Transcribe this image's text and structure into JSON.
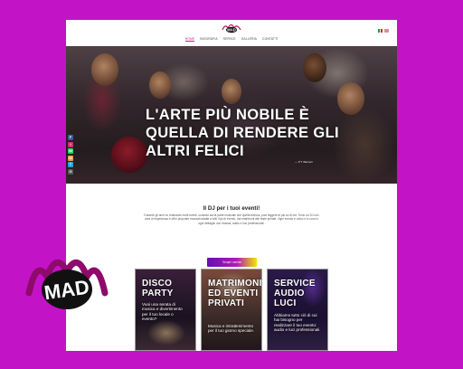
{
  "colors": {
    "background": "#c313c6",
    "accent": "#d1167a"
  },
  "nav": {
    "items": [
      "HOME",
      "BIOGRAFIA",
      "SERVIZI",
      "GALLERIA",
      "CONTATTI"
    ],
    "active": 0
  },
  "flags": [
    "flag-it-icon",
    "flag-en-icon"
  ],
  "hero": {
    "title": "L'ARTE PIÙ NOBILE È QUELLA DI RENDERE GLI ALTRI FELICI",
    "author": "— P.T. Barnum"
  },
  "social": [
    "F",
    "I",
    "W",
    "W",
    "T",
    "G"
  ],
  "intro": {
    "title": "Il DJ per i tuoi eventi!",
    "text": "Durante gli anni ho realizzato molti eventi, curando sia la parte musicale che quella tecnica, puoi leggere di più su di me. Sono un DJ con anni di esperienza e offro proposte musicali adatte a tutti i tipi di evento, dai matrimoni alle feste private. Ogni evento è unico e lo curo in ogni dettaglio con musica, audio e luci professionali.",
    "cta": "Scopri i servizi"
  },
  "cards": [
    {
      "title": "DISCO PARTY",
      "text": "Vuoi una serata di musica e divertimento per il tuo locale o evento?"
    },
    {
      "title": "MATRIMONI ED EVENTI PRIVATI",
      "text": "Musica e intrattenimento per il tuo giorno speciale."
    },
    {
      "title": "SERVICE AUDIO LUCI",
      "text": "Abbiamo tutto ciò di cui hai bisogno per realizzare il tuo evento: audio e luci professionali."
    }
  ],
  "brand": {
    "logo_text": "MAD"
  }
}
